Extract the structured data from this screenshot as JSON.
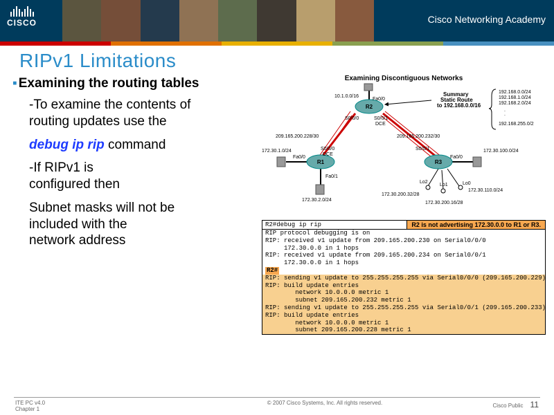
{
  "header": {
    "logo": "CISCO",
    "academy": "Cisco Networking Academy"
  },
  "slide": {
    "title": "RIPv1 Limitations",
    "heading": "Examining the routing tables",
    "line1a": "-To examine the contents of",
    "line1b": "routing updates use the",
    "line2_cmd": "debug ip rip",
    "line2_suffix": " command",
    "line3a": "-If RIPv1 is",
    "line3b": "configured then",
    "line4a": "Subnet masks will not be",
    "line4b": "included with the",
    "line4c": "network address"
  },
  "diagram": {
    "title": "Examining Discontiguous Networks",
    "summary_title": "Summary",
    "summary_route1": "Static Route",
    "summary_route2": "to 192.168.0.0/16",
    "nets": [
      "192.168.0.0/24",
      "192.168.1.0/24",
      "192.168.2.0/24",
      "192.168.255.0/2"
    ],
    "r2_top": "10.1.0.0/16",
    "r2_fa00": "Fa0/0",
    "link_left": "209.165.200.228/30",
    "link_right": "209.165.200.232/30",
    "r1_left": "172.30.1.0/24",
    "r1_bot": "172.30.2.0/24",
    "r3_right": "172.30.100.0/24",
    "r3_lo0": "172.30.110.0/24",
    "r3_lo1": "172.30.200.16/28",
    "r3_lo2": "172.30.200.32/28",
    "dce": "DCE",
    "s000": "S0/0/0",
    "s001": "S0/0/1",
    "fa00": "Fa0/0",
    "fa01": "Fa0/1",
    "lo0": "Lo0",
    "lo1": "Lo1",
    "lo2": "Lo2",
    "r1": "R1",
    "r2": "R2",
    "r3": "R3"
  },
  "terminal": {
    "cmd": "R2#debug ip rip",
    "note": "R2 is not advertising 172.30.0.0 to R1 or R3.",
    "l1": "RIP protocol debugging is on",
    "l2": "",
    "l3": "RIP: received v1 update from 209.165.200.230 on Serial0/0/0",
    "l4": "     172.30.0.0 in 1 hops",
    "l5": "RIP: received v1 update from 209.165.200.234 on Serial0/0/1",
    "l6": "     172.30.0.0 in 1 hops",
    "l7": "R2#",
    "l8": "RIP: sending v1 update to 255.255.255.255 via Serial0/0/0 (209.165.200.229)",
    "l9": "RIP: build update entries",
    "l10": "        network 10.0.0.0 metric 1",
    "l11": "        subnet 209.165.200.232 metric 1",
    "l12": "RIP: sending v1 update to 255.255.255.255 via Serial0/0/1 (209.165.200.233)",
    "l13": "RIP: build update entries",
    "l14": "        network 10.0.0.0 metric 1",
    "l15": "        subnet 209.165.200.228 metric 1"
  },
  "footer": {
    "left1": "ITE PC v4.0",
    "left2": "Chapter 1",
    "mid": "© 2007 Cisco Systems, Inc. All rights reserved.",
    "right": "Cisco Public",
    "page": "11"
  }
}
